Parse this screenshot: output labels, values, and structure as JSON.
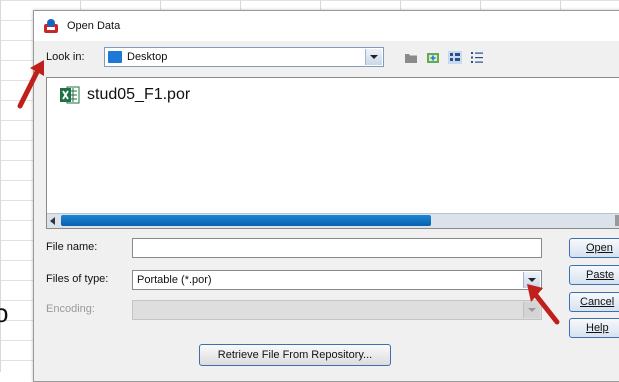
{
  "dialog": {
    "title": "Open Data",
    "look_in_label": "Look in:",
    "look_in_value": "Desktop",
    "toolbar_icons": [
      "up-folder-icon",
      "new-folder-icon",
      "list-view-icon",
      "details-view-icon"
    ]
  },
  "files": [
    {
      "name": "stud05_F1.por",
      "icon": "excel-file-icon"
    }
  ],
  "form": {
    "file_name_label": "File name:",
    "file_name_value": "",
    "files_of_type_label": "Files of type:",
    "files_of_type_value": "Portable (*.por)",
    "encoding_label": "Encoding:",
    "encoding_value": ""
  },
  "buttons": {
    "open": "Open",
    "paste": "Paste",
    "cancel": "Cancel",
    "help": "Help",
    "retrieve": "Retrieve File From Repository..."
  },
  "background": {
    "edge_letter": "o"
  },
  "colors": {
    "accent": "#1e79d6",
    "annotation_arrow": "#c0201c",
    "button_border": "#3f6fb3"
  }
}
